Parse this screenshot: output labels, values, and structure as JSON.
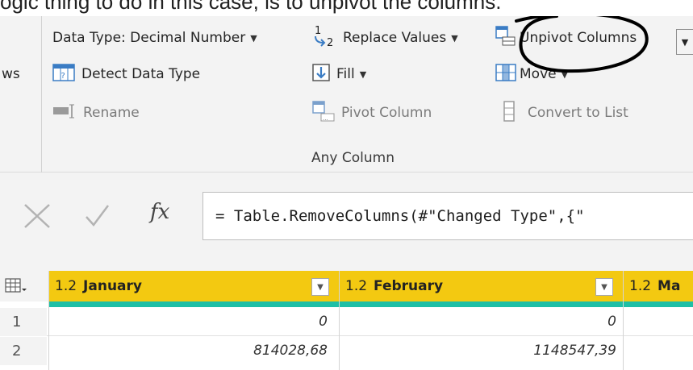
{
  "caption": "ogic thing to do in this case, is to unpivot the columns.",
  "ribbon": {
    "left_cut_label": "ws",
    "data_type": "Data Type: Decimal Number",
    "replace_values": "Replace Values",
    "unpivot_columns": "Unpivot Columns",
    "detect_data_type": "Detect Data Type",
    "fill": "Fill",
    "move": "Move",
    "rename": "Rename",
    "pivot_column": "Pivot Column",
    "convert_to_list": "Convert to List",
    "group_label": "Any Column",
    "annotation_color": "#000000"
  },
  "formula_bar": {
    "cancel_icon": "close-icon",
    "commit_icon": "checkmark-icon",
    "fx_label": "fx",
    "formula": "= Table.RemoveColumns(#\"Changed Type\",{\""
  },
  "grid": {
    "header_color": "#f3c911",
    "accent_color": "#1fbfa6",
    "columns": [
      {
        "type": "1.2",
        "name": "January"
      },
      {
        "type": "1.2",
        "name": "February"
      },
      {
        "type": "1.2",
        "name": "Ma"
      }
    ],
    "rows": [
      {
        "index": "1",
        "values": [
          "0",
          "0"
        ]
      },
      {
        "index": "2",
        "values": [
          "814028,68",
          "1148547,39"
        ]
      }
    ]
  }
}
